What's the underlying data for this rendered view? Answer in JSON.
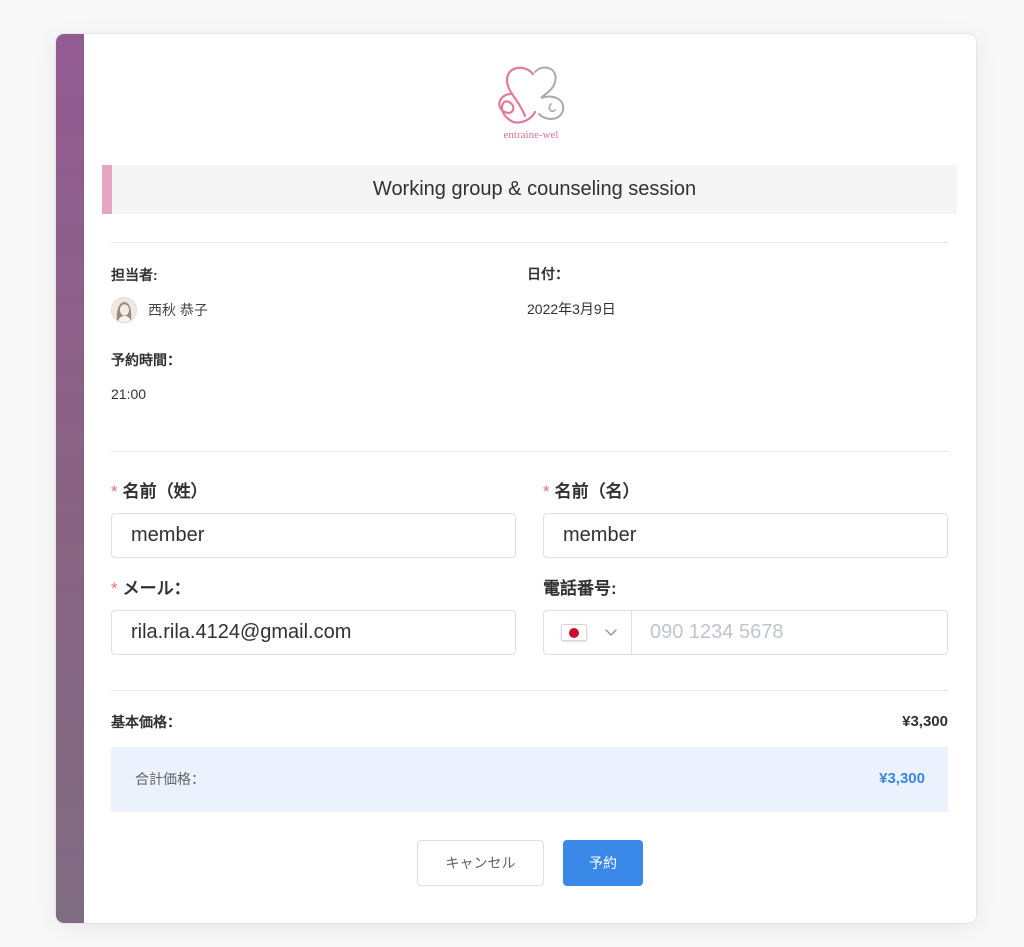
{
  "logo": {
    "text": "entraine-wel"
  },
  "session": {
    "title": "Working group & counseling session"
  },
  "info": {
    "staff_label": "担当者:",
    "staff_name": "西秋 恭子",
    "date_label": "日付：",
    "date_value": "2022年3月9日",
    "time_label": "予約時間：",
    "time_value": "21:00"
  },
  "form": {
    "required_mark": "*",
    "last_name": {
      "label": "名前（姓）",
      "value": "member"
    },
    "first_name": {
      "label": "名前（名）",
      "value": "member"
    },
    "email": {
      "label": "メール：",
      "value": "rila.rila.4124@gmail.com"
    },
    "phone": {
      "label": "電話番号:",
      "placeholder": "090 1234 5678"
    }
  },
  "pricing": {
    "base_label": "基本価格：",
    "base_value": "¥3,300",
    "total_label": "合計価格：",
    "total_value": "¥3,300"
  },
  "actions": {
    "cancel_label": "キャンセル",
    "submit_label": "予約"
  },
  "icons": {
    "logo": "butterfly-logo-icon",
    "country_flag": "japan-flag-icon",
    "country_dropdown": "chevron-down-icon"
  },
  "colors": {
    "side_strip": "#8a5f8a",
    "title_accent": "#e4a6c1",
    "primary": "#3a88e8",
    "required": "#f56c6c",
    "total_background": "#ebf2fd",
    "total_value": "#3a85df"
  }
}
